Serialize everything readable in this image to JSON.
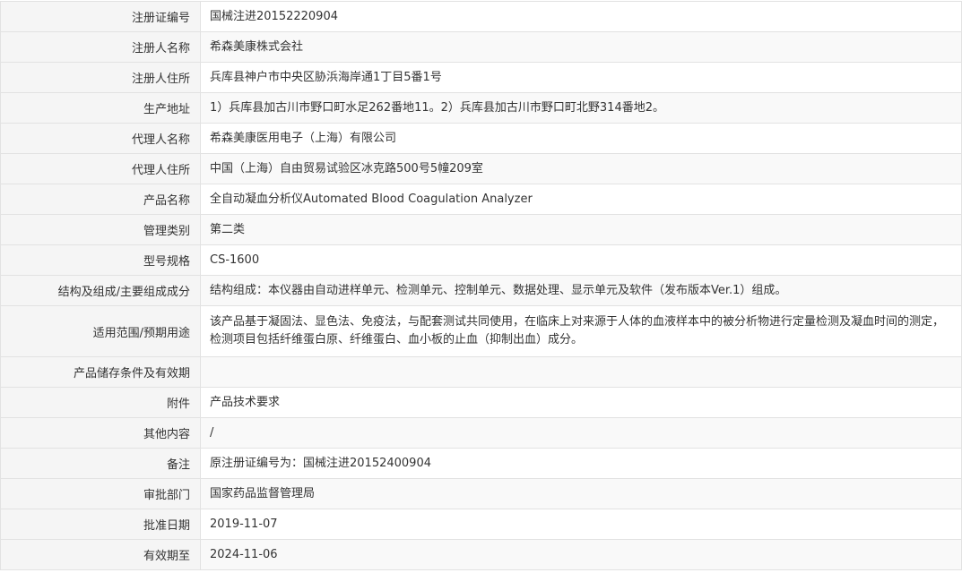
{
  "rows": [
    {
      "label": "注册证编号",
      "value": "国械注进20152220904"
    },
    {
      "label": "注册人名称",
      "value": "希森美康株式会社"
    },
    {
      "label": "注册人住所",
      "value": "兵库县神户市中央区胁浜海岸通1丁目5番1号"
    },
    {
      "label": "生产地址",
      "value": "1）兵库县加古川市野口町水足262番地11。2）兵库县加古川市野口町北野314番地2。"
    },
    {
      "label": "代理人名称",
      "value": "希森美康医用电子（上海）有限公司"
    },
    {
      "label": "代理人住所",
      "value": "中国（上海）自由贸易试验区冰克路500号5幢209室"
    },
    {
      "label": "产品名称",
      "value": "全自动凝血分析仪Automated Blood Coagulation Analyzer"
    },
    {
      "label": "管理类别",
      "value": "第二类"
    },
    {
      "label": "型号规格",
      "value": "CS-1600"
    },
    {
      "label": "结构及组成/主要组成成分",
      "value": "结构组成：本仪器由自动进样单元、检测单元、控制单元、数据处理、显示单元及软件（发布版本Ver.1）组成。"
    },
    {
      "label": "适用范围/预期用途",
      "value": "该产品基于凝固法、显色法、免疫法，与配套测试共同使用，在临床上对来源于人体的血液样本中的被分析物进行定量检测及凝血时间的测定，检测项目包括纤维蛋白原、纤维蛋白、血小板的止血（抑制出血）成分。"
    },
    {
      "label": "产品储存条件及有效期",
      "value": ""
    },
    {
      "label": "附件",
      "value": "产品技术要求"
    },
    {
      "label": "其他内容",
      "value": "/"
    },
    {
      "label": "备注",
      "value": "原注册证编号为：国械注进20152400904"
    },
    {
      "label": "审批部门",
      "value": "国家药品监督管理局"
    },
    {
      "label": "批准日期",
      "value": "2019-11-07"
    },
    {
      "label": "有效期至",
      "value": "2024-11-06"
    }
  ]
}
